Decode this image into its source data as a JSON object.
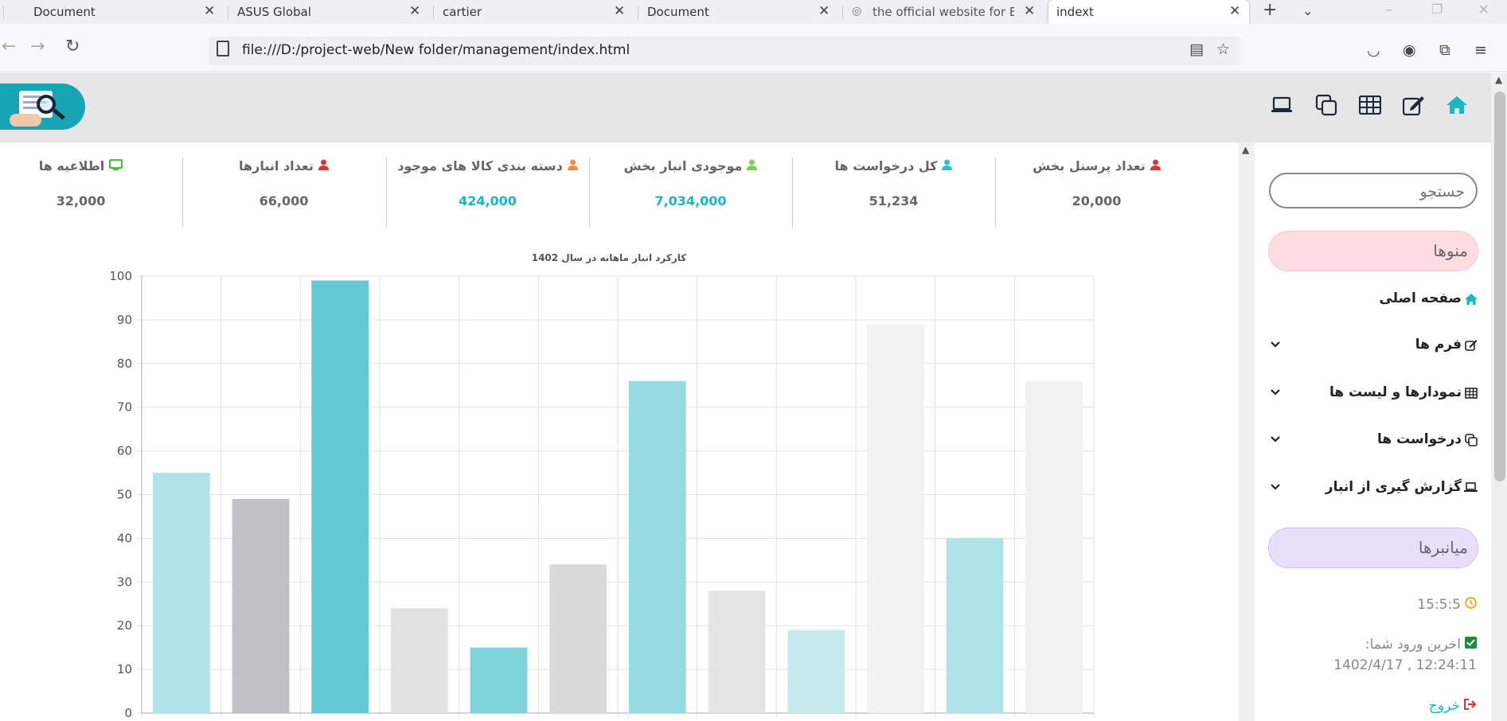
{
  "browser": {
    "tabs": [
      {
        "title": "Document"
      },
      {
        "title": "ASUS Global"
      },
      {
        "title": "cartier"
      },
      {
        "title": "Document"
      },
      {
        "title": "the official website for Europ"
      },
      {
        "title": "indext"
      }
    ],
    "url": "file:///D:/project-web/New folder/management/index.html"
  },
  "stats": [
    {
      "title": "تعداد پرسنل بخش",
      "value": "20,000",
      "icon": "user-icon",
      "icon_color": "#d9383a"
    },
    {
      "title": "کل درخواست ها",
      "value": "51,234",
      "icon": "user-icon",
      "icon_color": "#2cbfd9"
    },
    {
      "title": "موجودی انبار بخش",
      "value": "7,034,000",
      "icon": "user-icon",
      "icon_color": "#7ccf4f"
    },
    {
      "title": "دسته بندی کالا های موجود",
      "value": "424,000",
      "icon": "user-icon",
      "icon_color": "#f58b3c"
    },
    {
      "title": "تعداد انبارها",
      "value": "66,000",
      "icon": "user-icon",
      "icon_color": "#d9383a"
    },
    {
      "title": "اطلاعیه ها",
      "value": "32,000",
      "icon": "monitor-icon",
      "icon_color": "#37c437"
    }
  ],
  "chart_data": {
    "type": "bar",
    "title": "کارکرد انبار ماهانه در سال 1402",
    "values": [
      55,
      49,
      99,
      24,
      15,
      34,
      76,
      28,
      19,
      89,
      40,
      76
    ],
    "colors": [
      "#b0e3e8",
      "#c1c1c3",
      "#64c9d3",
      "#e2e2e2",
      "#7cd3da",
      "#d9d9d9",
      "#95dbe1",
      "#e4e4e4",
      "#c6eaed",
      "#f2f2f2",
      "#b0e3e8",
      "#f2f2f2"
    ],
    "ylim": [
      0,
      100
    ],
    "yticks": [
      "0",
      "10",
      "20",
      "30",
      "40",
      "50",
      "60",
      "70",
      "80",
      "90",
      "100"
    ],
    "grid": true
  },
  "sidebar": {
    "search_placeholder": "جستجو",
    "menus_label": "منوها",
    "shortcuts_label": "میانبرها",
    "items": [
      {
        "label": "صفحه اصلی",
        "icon": "home-icon"
      },
      {
        "label": "فرم ها",
        "icon": "edit-icon"
      },
      {
        "label": "نمودارها و لیست ها",
        "icon": "table-icon"
      },
      {
        "label": "درخواست ها",
        "icon": "copy-icon"
      },
      {
        "label": "گزارش گیری از انبار",
        "icon": "laptop-icon"
      }
    ],
    "clock": "15:5:5",
    "last_login_label": "اخرین ورود شما:",
    "last_login_value": "1402/4/17 , 12:24:11",
    "logout_label": "خروج"
  },
  "colors": {
    "accent": "#19b6c4",
    "header_bg": "#e6e6e6"
  }
}
